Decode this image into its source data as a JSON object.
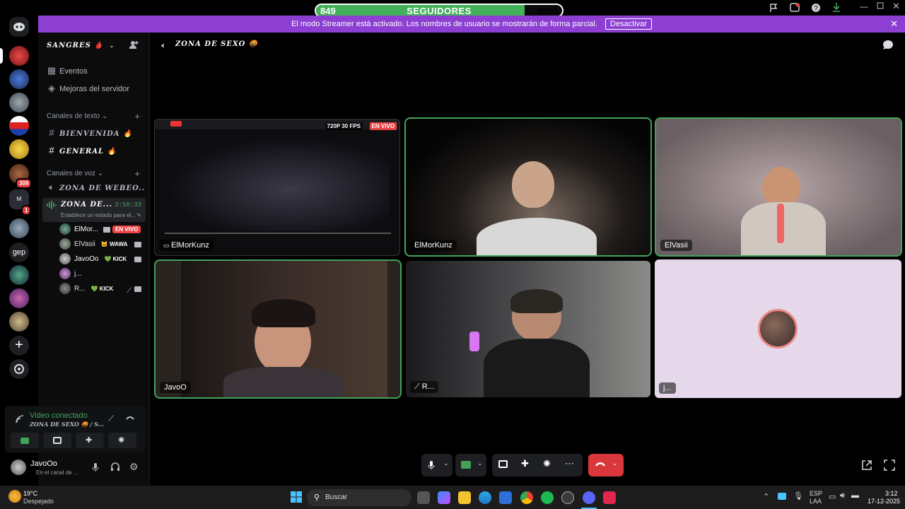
{
  "follow_bar": {
    "current": "849",
    "label": "SEGUIDORES",
    "goal": "1000",
    "progress": 0.849
  },
  "banner": {
    "text": "El modo Streamer está activado. Los nombres de usuario se mostrarán de forma parcial.",
    "button": "Desactivar"
  },
  "server": {
    "name": "SANGRES 🩸"
  },
  "sidebar": {
    "events": "Eventos",
    "boosts": "Mejoras del servidor",
    "text_category": "Canales de texto",
    "text_channels": [
      {
        "name": "BIENVENIDA 🔥"
      },
      {
        "name": "GENERAL 🔥"
      }
    ],
    "voice_category": "Canales de voz",
    "voice_channels": [
      {
        "name": "ZONA DE WEBEO..."
      },
      {
        "name": "ZONA DE...",
        "timer": "3:58:33",
        "status": "Establece un estado para el..."
      }
    ],
    "voice_users": [
      {
        "name": "ElMor...",
        "tag": "EN VIVO"
      },
      {
        "name": "ElVasii",
        "tag": "🐱 WAWA"
      },
      {
        "name": "JavoOo",
        "tag": "💚 KICK"
      },
      {
        "name": "j..."
      },
      {
        "name": "R...",
        "tag": "💚 KICK"
      }
    ]
  },
  "voice_panel": {
    "status": "Video conectado",
    "channel": "ZONA DE SEXO 🤬 / S..."
  },
  "user_panel": {
    "name": "JavoOo",
    "status": "En el canal de ..."
  },
  "stage": {
    "channel_title": "ZONA DE SEXO 🤬",
    "tiles": [
      {
        "name": "ElMorKunz",
        "quality": "720P 30 FPS",
        "live": "EN VIVO"
      },
      {
        "name": "ElMorKunz"
      },
      {
        "name": "ElVasii"
      },
      {
        "name": "JavoO"
      },
      {
        "name": "R..."
      },
      {
        "name": "j..."
      }
    ]
  },
  "taskbar": {
    "weather_temp": "19°C",
    "weather_desc": "Despejado",
    "search": "Buscar",
    "lang1": "ESP",
    "lang2": "LAA",
    "time": "3:12",
    "date": "17-12-2025"
  },
  "rail_badges": {
    "a": "309",
    "b": "1"
  },
  "rail_text": {
    "gep": "gep",
    "m": "M"
  },
  "colors": {
    "accent": "#43a25a",
    "banner": "#8c3fd1",
    "live": "#ed4245",
    "hangup": "#da373c"
  }
}
